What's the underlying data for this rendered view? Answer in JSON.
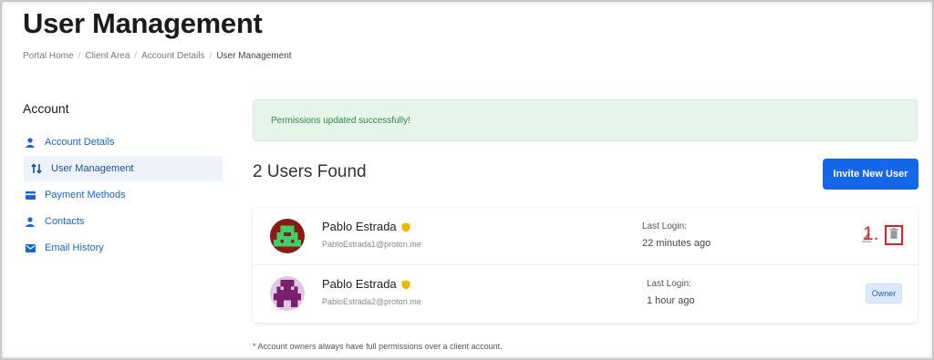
{
  "page": {
    "title": "User Management"
  },
  "breadcrumb": [
    {
      "label": "Portal Home"
    },
    {
      "label": "Client Area"
    },
    {
      "label": "Account Details"
    },
    {
      "label": "User Management"
    }
  ],
  "sidebar": {
    "title": "Account",
    "items": [
      {
        "label": "Account Details",
        "icon": "user-icon"
      },
      {
        "label": "User Management",
        "icon": "arrows-updown-icon",
        "active": true
      },
      {
        "label": "Payment Methods",
        "icon": "credit-card-icon"
      },
      {
        "label": "Contacts",
        "icon": "user-icon"
      },
      {
        "label": "Email History",
        "icon": "envelope-icon"
      }
    ]
  },
  "alert": {
    "message": "Permissions updated successfully!"
  },
  "users": {
    "heading": "2 Users Found",
    "invite_label": "Invite New User",
    "rows": [
      {
        "name": "Pablo Estrada",
        "email": "PabloEstrada1@proton.me",
        "last_login_label": "Last Login:",
        "last_login_value": "22 minutes ago",
        "annotation": "1."
      },
      {
        "name": "Pablo Estrada",
        "email": "PabloEstrada2@proton.me",
        "last_login_label": "Last Login:",
        "last_login_value": "1 hour ago",
        "badge": "Owner"
      }
    ],
    "footnote": "* Account owners always have full permissions over a client account."
  },
  "colors": {
    "primary": "#1566e8",
    "link": "#1565d8",
    "success_bg": "#e6f4ea",
    "success_text": "#2e8a43",
    "annotation": "#e02020",
    "shield": "#f2b600"
  }
}
